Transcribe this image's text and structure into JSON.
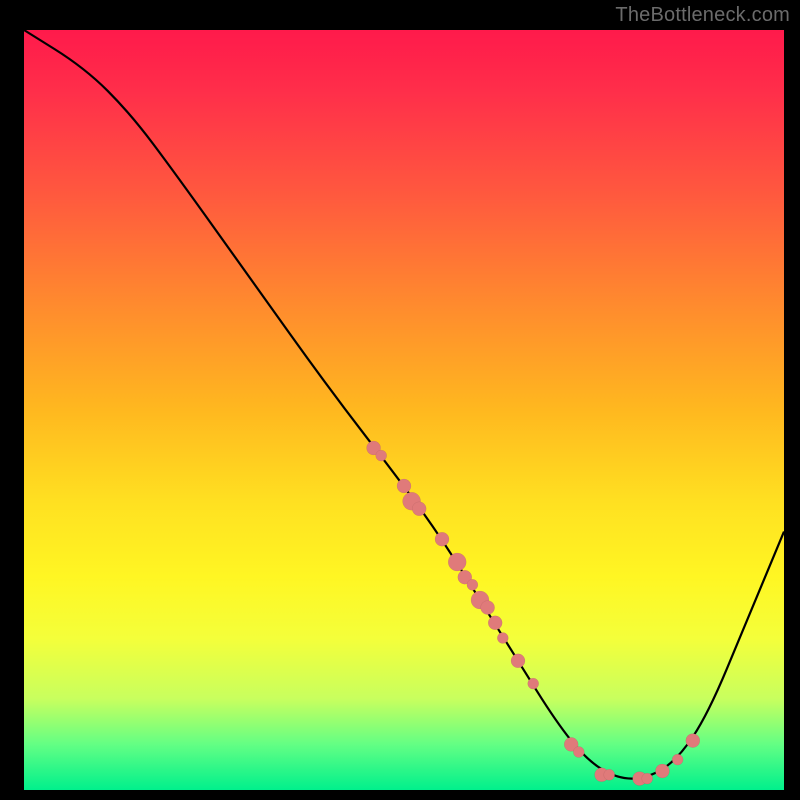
{
  "attribution": "TheBottleneck.com",
  "chart_data": {
    "type": "line",
    "title": "",
    "xlabel": "",
    "ylabel": "",
    "xlim": [
      0,
      100
    ],
    "ylim": [
      0,
      100
    ],
    "grid": false,
    "legend": false,
    "curve": [
      {
        "x": 0,
        "y": 100
      },
      {
        "x": 8,
        "y": 95
      },
      {
        "x": 14,
        "y": 89
      },
      {
        "x": 20,
        "y": 81
      },
      {
        "x": 30,
        "y": 67
      },
      {
        "x": 40,
        "y": 53
      },
      {
        "x": 50,
        "y": 40
      },
      {
        "x": 55,
        "y": 33
      },
      {
        "x": 60,
        "y": 25
      },
      {
        "x": 65,
        "y": 17
      },
      {
        "x": 70,
        "y": 9
      },
      {
        "x": 74,
        "y": 4
      },
      {
        "x": 78,
        "y": 1.5
      },
      {
        "x": 82,
        "y": 1.5
      },
      {
        "x": 86,
        "y": 4
      },
      {
        "x": 90,
        "y": 10
      },
      {
        "x": 95,
        "y": 22
      },
      {
        "x": 100,
        "y": 34
      }
    ],
    "points": [
      {
        "x": 46,
        "y": 45,
        "size": "med"
      },
      {
        "x": 47,
        "y": 44,
        "size": "sm"
      },
      {
        "x": 50,
        "y": 40,
        "size": "med"
      },
      {
        "x": 51,
        "y": 38,
        "size": "big"
      },
      {
        "x": 52,
        "y": 37,
        "size": "med"
      },
      {
        "x": 55,
        "y": 33,
        "size": "med"
      },
      {
        "x": 57,
        "y": 30,
        "size": "big"
      },
      {
        "x": 58,
        "y": 28,
        "size": "med"
      },
      {
        "x": 59,
        "y": 27,
        "size": "sm"
      },
      {
        "x": 60,
        "y": 25,
        "size": "big"
      },
      {
        "x": 61,
        "y": 24,
        "size": "med"
      },
      {
        "x": 62,
        "y": 22,
        "size": "med"
      },
      {
        "x": 63,
        "y": 20,
        "size": "sm"
      },
      {
        "x": 65,
        "y": 17,
        "size": "med"
      },
      {
        "x": 67,
        "y": 14,
        "size": "sm"
      },
      {
        "x": 72,
        "y": 6,
        "size": "med"
      },
      {
        "x": 73,
        "y": 5,
        "size": "sm"
      },
      {
        "x": 76,
        "y": 2,
        "size": "med"
      },
      {
        "x": 77,
        "y": 2,
        "size": "sm"
      },
      {
        "x": 81,
        "y": 1.5,
        "size": "med"
      },
      {
        "x": 82,
        "y": 1.5,
        "size": "sm"
      },
      {
        "x": 84,
        "y": 2.5,
        "size": "med"
      },
      {
        "x": 86,
        "y": 4,
        "size": "sm"
      },
      {
        "x": 88,
        "y": 6.5,
        "size": "med"
      }
    ]
  }
}
